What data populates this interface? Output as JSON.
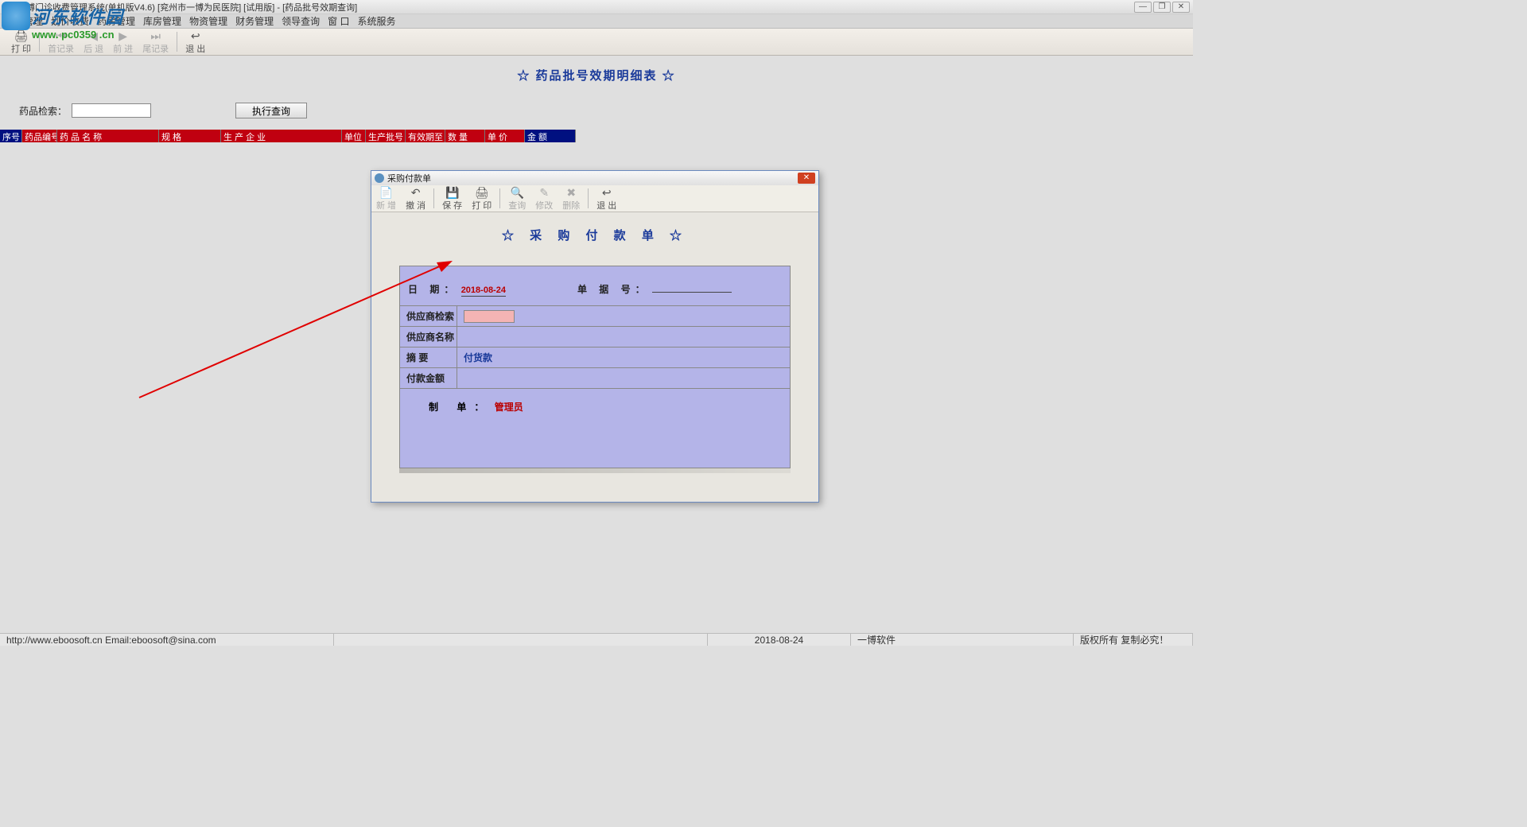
{
  "title": "一博门诊收费管理系统(单机版V4.6)   [兖州市一博为民医院]   [试用版] - [药品批号效期查询]",
  "watermark": {
    "brand": "河东软件园",
    "url": "www. pc0359 .cn"
  },
  "menu": [
    "挂号管理",
    "划价收费",
    "药房管理",
    "库房管理",
    "物资管理",
    "财务管理",
    "领导查询",
    "窗  口",
    "系统服务"
  ],
  "toolbar": {
    "print": "打 印",
    "first": "首记录",
    "back": "后 退",
    "fwd": "前 进",
    "last": "尾记录",
    "exit": "退 出"
  },
  "report": {
    "title": "☆  药品批号效期明细表  ☆",
    "search_label": "药品检索：",
    "exec_btn": "执行查询",
    "headers": [
      "序号",
      "药品编号",
      "药 品 名 称",
      "规 格",
      "生 产 企 业",
      "单位",
      "生产批号",
      "有效期至",
      "数   量",
      "单   价",
      "金     额"
    ]
  },
  "dialog": {
    "title": "采购付款单",
    "toolbar": {
      "new": "新 增",
      "undo": "撤 消",
      "save": "保 存",
      "print": "打 印",
      "query": "查询",
      "modify": "修改",
      "delete": "删除",
      "exit": "退 出"
    },
    "heading": "☆   采 购 付 款 单   ☆",
    "date_label": "日     期：",
    "date_value": "2018-08-24",
    "bill_label": "单 据 号：",
    "rows": {
      "vendor_search": "供应商检索",
      "vendor_name": "供应商名称",
      "summary": "摘   要",
      "summary_value": "付货款",
      "amount": "付款金额"
    },
    "maker_label": "制     单：",
    "maker_value": "管理员"
  },
  "statusbar": {
    "url": "http://www.eboosoft.cn   Email:eboosoft@sina.com",
    "date": "2018-08-24",
    "company": "一博软件",
    "copyright": "版权所有  复制必究！"
  },
  "win_controls": {
    "min": "—",
    "restore": "❐",
    "close": "✕"
  }
}
